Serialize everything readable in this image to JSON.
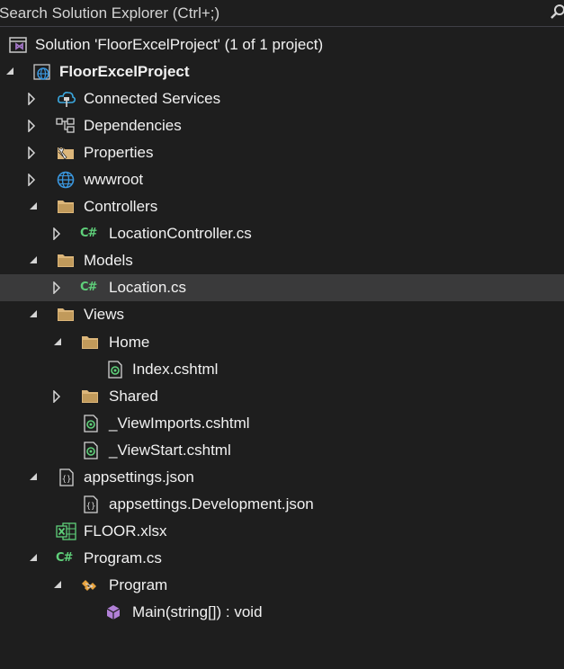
{
  "search": {
    "placeholder": "Search Solution Explorer (Ctrl+;)"
  },
  "tree": {
    "solution": "Solution 'FloorExcelProject' (1 of 1 project)",
    "project": "FloorExcelProject",
    "connected_services": "Connected Services",
    "dependencies": "Dependencies",
    "properties": "Properties",
    "wwwroot": "wwwroot",
    "controllers": "Controllers",
    "location_controller": "LocationController.cs",
    "models": "Models",
    "location": "Location.cs",
    "views": "Views",
    "home": "Home",
    "index": "Index.cshtml",
    "shared": "Shared",
    "view_imports": "_ViewImports.cshtml",
    "view_start": "_ViewStart.cshtml",
    "appsettings": "appsettings.json",
    "appsettings_dev": "appsettings.Development.json",
    "floor": "FLOOR.xlsx",
    "program_cs": "Program.cs",
    "program_class": "Program",
    "main_method": "Main(string[]) : void"
  },
  "icons": {
    "cs_glyph": "C#",
    "razor_glyph": "@",
    "json_glyph": "{}",
    "excel_glyph": "X"
  },
  "colors": {
    "background": "#1e1e1e",
    "selected_row": "#3a3a3b",
    "folder": "#dcb67a",
    "csharp": "#5fd07a",
    "solution": "#a074c4",
    "globe": "#3a96dd"
  }
}
